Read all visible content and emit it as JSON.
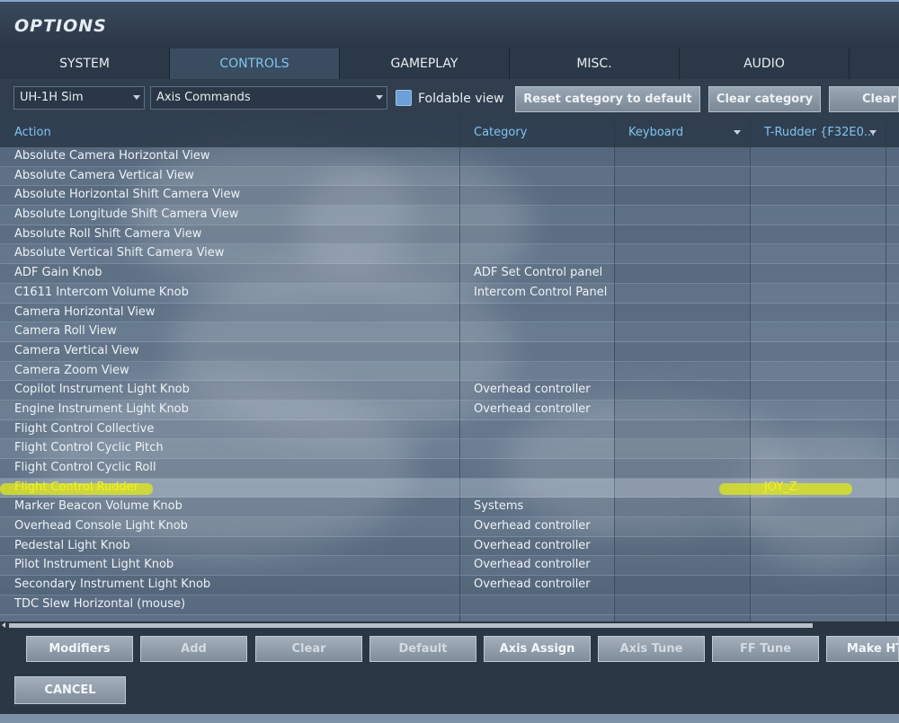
{
  "window": {
    "title": "OPTIONS"
  },
  "tabs": [
    {
      "label": "SYSTEM",
      "active": false
    },
    {
      "label": "CONTROLS",
      "active": true
    },
    {
      "label": "GAMEPLAY",
      "active": false
    },
    {
      "label": "MISC.",
      "active": false
    },
    {
      "label": "AUDIO",
      "active": false
    }
  ],
  "toolbar": {
    "aircraft_select": "UH-1H Sim",
    "category_select": "Axis Commands",
    "foldable_view_label": "Foldable view",
    "foldable_view_checked": true,
    "reset_category_label": "Reset category to default",
    "clear_category_label": "Clear category",
    "clear_all_label": "Clear a"
  },
  "table": {
    "headers": {
      "action": "Action",
      "category": "Category",
      "keyboard": "Keyboard",
      "device": "T-Rudder {F32E0..."
    },
    "rows": [
      {
        "action": "Absolute Camera Horizontal View",
        "category": "",
        "device": ""
      },
      {
        "action": "Absolute Camera Vertical View",
        "category": "",
        "device": ""
      },
      {
        "action": "Absolute Horizontal Shift Camera View",
        "category": "",
        "device": ""
      },
      {
        "action": "Absolute Longitude Shift Camera View",
        "category": "",
        "device": ""
      },
      {
        "action": "Absolute Roll Shift Camera View",
        "category": "",
        "device": ""
      },
      {
        "action": "Absolute Vertical Shift Camera View",
        "category": "",
        "device": ""
      },
      {
        "action": "ADF Gain Knob",
        "category": "ADF Set Control panel",
        "device": ""
      },
      {
        "action": "C1611 Intercom Volume Knob",
        "category": "Intercom Control Panel",
        "device": ""
      },
      {
        "action": "Camera Horizontal View",
        "category": "",
        "device": ""
      },
      {
        "action": "Camera Roll View",
        "category": "",
        "device": ""
      },
      {
        "action": "Camera Vertical View",
        "category": "",
        "device": ""
      },
      {
        "action": "Camera Zoom View",
        "category": "",
        "device": ""
      },
      {
        "action": "Copilot Instrument Light Knob",
        "category": "Overhead controller",
        "device": ""
      },
      {
        "action": "Engine Instrument Light Knob",
        "category": "Overhead controller",
        "device": ""
      },
      {
        "action": "Flight Control Collective",
        "category": "",
        "device": ""
      },
      {
        "action": "Flight Control Cyclic Pitch",
        "category": "",
        "device": ""
      },
      {
        "action": "Flight Control Cyclic Roll",
        "category": "",
        "device": ""
      },
      {
        "action": "Flight Control Rudder",
        "category": "",
        "device": "JOY_Z",
        "highlighted": true
      },
      {
        "action": "Marker Beacon Volume Knob",
        "category": "Systems",
        "device": ""
      },
      {
        "action": "Overhead Console Light Knob",
        "category": "Overhead controller",
        "device": ""
      },
      {
        "action": "Pedestal Light Knob",
        "category": "Overhead controller",
        "device": ""
      },
      {
        "action": "Pilot Instrument Light Knob",
        "category": "Overhead controller",
        "device": ""
      },
      {
        "action": "Secondary Instrument Light Knob",
        "category": "Overhead controller",
        "device": ""
      },
      {
        "action": "TDC Slew Horizontal (mouse)",
        "category": "",
        "device": ""
      }
    ]
  },
  "bottom_buttons": {
    "modifiers": "Modifiers",
    "add": "Add",
    "clear": "Clear",
    "default": "Default",
    "axis_assign": "Axis Assign",
    "axis_tune": "Axis Tune",
    "ff_tune": "FF Tune",
    "make_html": "Make HTM",
    "cancel": "CANCEL"
  },
  "colors": {
    "accent_text": "#7fc4ef",
    "highlight_text": "#f2f226",
    "marker": "#e1e814"
  }
}
